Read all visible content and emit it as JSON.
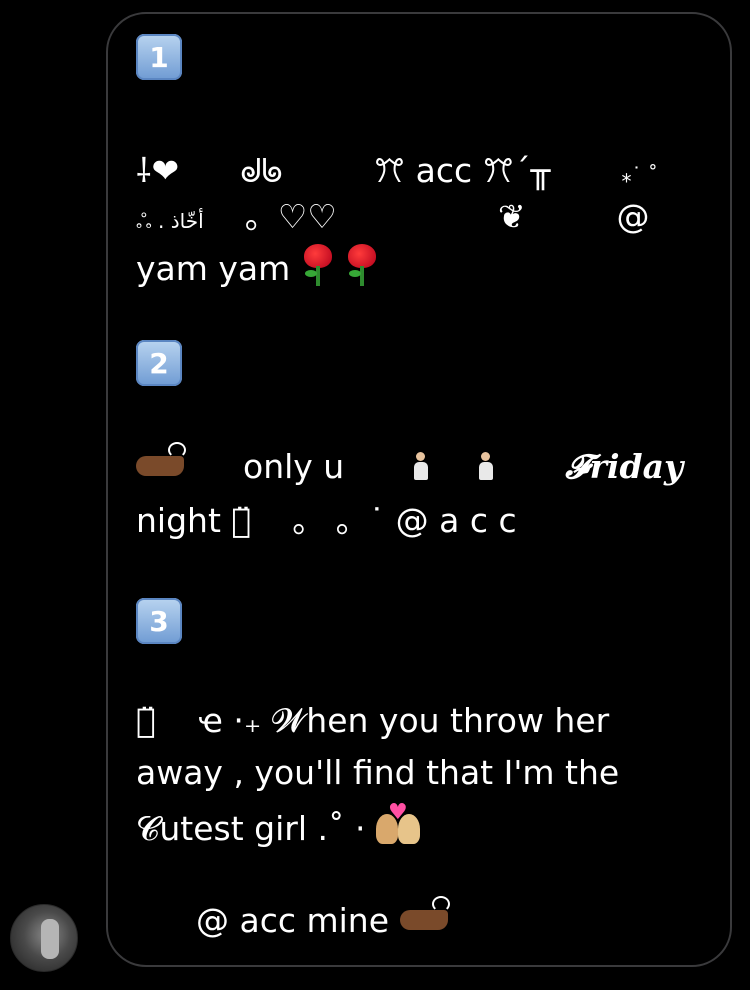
{
  "message": {
    "section1": {
      "badge": "1",
      "line1_a": "⸸❤︎",
      "line1_b": "ᖙᖚ",
      "line1_c": "ꔫ acc ꔫ´╥",
      "line1_d": "⁎˙ ˚",
      "line2_a": "ஃ . أخّاذ",
      "line2_b": "。♡♡",
      "line2_c": "❦",
      "line2_d": "@",
      "line3_text": "yam yam"
    },
    "section2": {
      "badge": "2",
      "line1_a": "only u",
      "line1_b": "𝓕riday",
      "line2_a": "night ⓪̈",
      "line2_b": "。  。˙ @ a c c"
    },
    "section3": {
      "badge": "3",
      "line1_a": "⓪̈",
      "line1_b": "ҽ ·₊ 𝓦hen you throw her",
      "line2": "away ,  you'll find that I'm the",
      "line3": "𝓒utest girl .˚ ·",
      "line4": "@ acc  mine"
    }
  },
  "icons": {
    "rose": "rose-icon",
    "hand": "pointing-hand-icon",
    "pray": "kneeling-person-icon",
    "couple": "couple-with-heart-icon",
    "avatar": "avatar"
  },
  "colors": {
    "background": "#000000",
    "bubble_border": "#3a3a3c",
    "text": "#ffffff",
    "badge": "#6f9bd3"
  }
}
